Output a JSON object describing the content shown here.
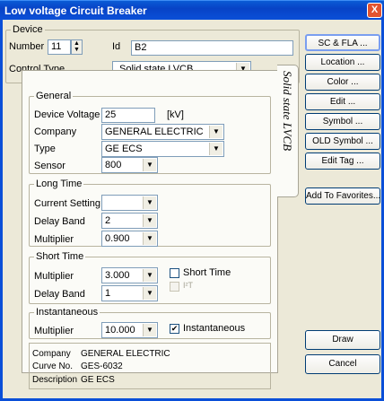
{
  "window": {
    "title": "Low voltage Circuit Breaker",
    "close": "X"
  },
  "device": {
    "legend": "Device",
    "number_label": "Number",
    "number_value": "11",
    "id_label": "Id",
    "id_value": "B2",
    "control_type_label": "Control Type",
    "control_type_value": "Solid state LVCB"
  },
  "tab": {
    "label": "Solid state LVCB"
  },
  "general": {
    "legend": "General",
    "voltage_label": "Device Voltage",
    "voltage_value": "25",
    "voltage_unit": "[kV]",
    "company_label": "Company",
    "company_value": "GENERAL ELECTRIC",
    "type_label": "Type",
    "type_value": "GE ECS",
    "sensor_label": "Sensor",
    "sensor_value": "800"
  },
  "long_time": {
    "legend": "Long Time",
    "current_setting_label": "Current Setting",
    "current_setting_value": "",
    "delay_band_label": "Delay Band",
    "delay_band_value": "2",
    "multiplier_label": "Multiplier",
    "multiplier_value": "0.900"
  },
  "short_time": {
    "legend": "Short Time",
    "multiplier_label": "Multiplier",
    "multiplier_value": "3.000",
    "delay_band_label": "Delay Band",
    "delay_band_value": "1",
    "short_time_check_label": "Short Time",
    "short_time_checked": false,
    "i2t_label": "I²T",
    "i2t_checked": false
  },
  "instantaneous": {
    "legend": "Instantaneous",
    "multiplier_label": "Multiplier",
    "multiplier_value": "10.000",
    "check_label": "Instantaneous",
    "checked": true
  },
  "info": {
    "company_label": "Company",
    "company_value": "GENERAL ELECTRIC",
    "curve_label": "Curve No.",
    "curve_value": "GES-6032",
    "description_label": "Description",
    "description_value": "GE ECS"
  },
  "buttons": {
    "sc_fla": "SC & FLA ...",
    "location": "Location ...",
    "color": "Color ...",
    "edit": "Edit ...",
    "symbol": "Symbol ...",
    "old_symbol": "OLD Symbol ...",
    "edit_tag": "Edit Tag ...",
    "add_favorites": "Add To Favorites...",
    "draw": "Draw",
    "cancel": "Cancel"
  },
  "icons": {
    "dropdown": "chevron-down-icon",
    "check": "checkmark-icon",
    "spin": "spin-arrows-icon"
  }
}
